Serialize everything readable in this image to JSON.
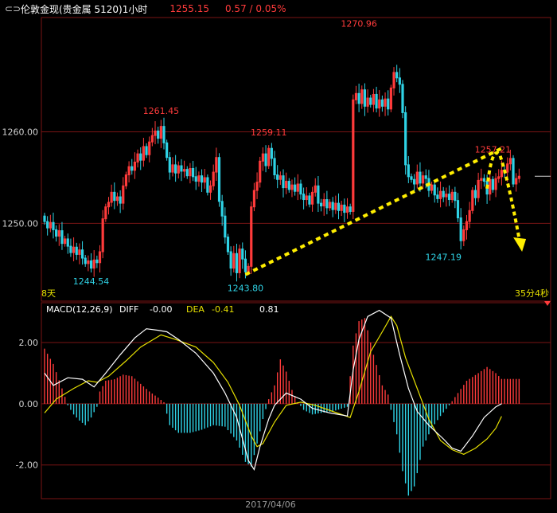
{
  "header": {
    "title": "伦敦金现(贵金属 5120)1小时",
    "last_price": "1255.15",
    "change": "0.57 / 0.05%",
    "link_icon": "link-icon"
  },
  "colors": {
    "background": "#000000",
    "up": "#ff3b3b",
    "down": "#2fd3e6",
    "grid": "#7a1414",
    "axis_text": "#d0d0d0",
    "diff_line": "#ffffff",
    "dea_line": "#e6e000",
    "trend": "#ffee00"
  },
  "chart_data": [
    {
      "type": "candlestick",
      "y_ticks": [
        "1260.00",
        "1250.00"
      ],
      "ylim": [
        1241.5,
        1272.5
      ],
      "annotations": [
        {
          "text": "1261.45",
          "bar": 40,
          "value": 1261.45
        },
        {
          "text": "1270.96",
          "bar": 108,
          "value": 1270.96
        },
        {
          "text": "1259.11",
          "bar": 77,
          "value": 1259.11
        },
        {
          "text": "1257.21",
          "bar": 154,
          "value": 1257.21
        },
        {
          "text": "1244.54",
          "bar": 16,
          "value": 1244.54
        },
        {
          "text": "1243.80",
          "bar": 69,
          "value": 1243.8
        },
        {
          "text": "1247.19",
          "bar": 137,
          "value": 1247.19
        }
      ],
      "corner_left": "8天",
      "corner_right": "35分4秒",
      "x_label": "2017/04/06",
      "closes": [
        1250.2,
        1249.5,
        1250.1,
        1249.3,
        1248.6,
        1249.2,
        1247.8,
        1248.3,
        1247.5,
        1246.8,
        1247.4,
        1246.6,
        1247.1,
        1246.2,
        1245.6,
        1245.9,
        1245.1,
        1246.0,
        1245.7,
        1246.9,
        1250.5,
        1251.8,
        1252.3,
        1253.4,
        1252.5,
        1252.9,
        1252.2,
        1254.1,
        1255.3,
        1256.2,
        1255.8,
        1256.7,
        1257.6,
        1256.9,
        1258.4,
        1257.5,
        1258.9,
        1259.6,
        1260.1,
        1259.3,
        1260.6,
        1258.8,
        1257.2,
        1255.6,
        1256.4,
        1255.5,
        1256.3,
        1255.7,
        1255.9,
        1255.2,
        1256.0,
        1255.1,
        1254.6,
        1255.2,
        1254.5,
        1255.0,
        1253.4,
        1254.1,
        1255.6,
        1257.2,
        1252.4,
        1250.8,
        1248.5,
        1246.9,
        1245.1,
        1246.7,
        1244.6,
        1247.2,
        1246.1,
        1244.7,
        1245.3,
        1251.8,
        1253.6,
        1254.5,
        1256.8,
        1257.6,
        1256.3,
        1258.2,
        1257.1,
        1255.3,
        1254.8,
        1255.2,
        1253.9,
        1254.6,
        1253.7,
        1254.2,
        1253.5,
        1254.3,
        1253.2,
        1252.6,
        1253.0,
        1252.1,
        1253.4,
        1254.1,
        1252.2,
        1251.9,
        1252.6,
        1251.7,
        1252.3,
        1251.5,
        1252.2,
        1251.4,
        1252.0,
        1251.2,
        1251.8,
        1251.3,
        1263.5,
        1264.2,
        1263.1,
        1264.6,
        1262.8,
        1263.7,
        1263.0,
        1264.1,
        1262.6,
        1263.5,
        1262.8,
        1263.6,
        1262.5,
        1264.8,
        1266.5,
        1265.9,
        1265.2,
        1262.1,
        1256.4,
        1255.1,
        1254.8,
        1254.3,
        1255.6,
        1254.4,
        1255.2,
        1254.9,
        1253.6,
        1254.2,
        1253.1,
        1252.7,
        1253.5,
        1252.9,
        1253.2,
        1252.6,
        1253.4,
        1252.5,
        1250.6,
        1248.1,
        1249.3,
        1250.2,
        1251.4,
        1253.6,
        1252.8,
        1254.7,
        1254.9,
        1254.6,
        1253.2,
        1254.8,
        1253.7,
        1254.9,
        1255.1,
        1255.8,
        1255.6,
        1256.5,
        1257.1,
        1254.3,
        1254.9,
        1255.15
      ]
    },
    {
      "type": "macd",
      "legend": {
        "name": "MACD(12,26,9)",
        "diff_label": "DIFF",
        "diff_value": "-0.00",
        "dea_label": "DEA",
        "dea_value": "-0.41",
        "macd_value": "0.81"
      },
      "y_ticks": [
        "2.00",
        "0.00",
        "-2.00"
      ],
      "ylim": [
        -3.1,
        3.3
      ],
      "diff_points": [
        [
          0,
          1.0
        ],
        [
          3,
          0.6
        ],
        [
          8,
          0.85
        ],
        [
          13,
          0.8
        ],
        [
          17,
          0.55
        ],
        [
          21,
          1.0
        ],
        [
          26,
          1.6
        ],
        [
          31,
          2.15
        ],
        [
          35,
          2.45
        ],
        [
          39,
          2.4
        ],
        [
          42,
          2.35
        ],
        [
          46,
          2.1
        ],
        [
          52,
          1.65
        ],
        [
          58,
          1.0
        ],
        [
          62,
          0.35
        ],
        [
          66,
          -0.45
        ],
        [
          70,
          -1.85
        ],
        [
          72,
          -2.15
        ],
        [
          74,
          -1.4
        ],
        [
          77,
          -0.5
        ],
        [
          79,
          -0.05
        ],
        [
          83,
          0.35
        ],
        [
          88,
          0.15
        ],
        [
          92,
          -0.15
        ],
        [
          98,
          -0.3
        ],
        [
          104,
          -0.4
        ],
        [
          106,
          1.1
        ],
        [
          108,
          2.1
        ],
        [
          111,
          2.85
        ],
        [
          115,
          3.05
        ],
        [
          119,
          2.8
        ],
        [
          122,
          1.6
        ],
        [
          125,
          0.5
        ],
        [
          128,
          -0.25
        ],
        [
          132,
          -0.7
        ],
        [
          137,
          -1.15
        ],
        [
          140,
          -1.45
        ],
        [
          143,
          -1.55
        ],
        [
          147,
          -1.05
        ],
        [
          151,
          -0.45
        ],
        [
          155,
          -0.1
        ],
        [
          157,
          0.0
        ]
      ],
      "dea_points": [
        [
          0,
          -0.3
        ],
        [
          4,
          0.15
        ],
        [
          10,
          0.5
        ],
        [
          15,
          0.75
        ],
        [
          18,
          0.7
        ],
        [
          22,
          0.9
        ],
        [
          28,
          1.4
        ],
        [
          33,
          1.85
        ],
        [
          40,
          2.25
        ],
        [
          45,
          2.1
        ],
        [
          52,
          1.85
        ],
        [
          58,
          1.35
        ],
        [
          63,
          0.7
        ],
        [
          67,
          -0.05
        ],
        [
          71,
          -1.05
        ],
        [
          73,
          -1.4
        ],
        [
          75,
          -1.3
        ],
        [
          79,
          -0.6
        ],
        [
          83,
          -0.05
        ],
        [
          88,
          0.05
        ],
        [
          93,
          -0.05
        ],
        [
          99,
          -0.25
        ],
        [
          105,
          -0.45
        ],
        [
          108,
          0.4
        ],
        [
          112,
          1.7
        ],
        [
          116,
          2.35
        ],
        [
          119,
          2.85
        ],
        [
          121,
          2.55
        ],
        [
          124,
          1.5
        ],
        [
          128,
          0.5
        ],
        [
          132,
          -0.5
        ],
        [
          136,
          -1.2
        ],
        [
          140,
          -1.5
        ],
        [
          144,
          -1.65
        ],
        [
          148,
          -1.45
        ],
        [
          152,
          -1.15
        ],
        [
          155,
          -0.8
        ],
        [
          157,
          -0.41
        ]
      ],
      "hist_points": [
        [
          0,
          1.8
        ],
        [
          3,
          1.3
        ],
        [
          6,
          0.5
        ],
        [
          8,
          -0.05
        ],
        [
          10,
          -0.35
        ],
        [
          12,
          -0.55
        ],
        [
          14,
          -0.7
        ],
        [
          16,
          -0.45
        ],
        [
          18,
          -0.1
        ],
        [
          19,
          0.4
        ],
        [
          21,
          0.75
        ],
        [
          24,
          0.8
        ],
        [
          27,
          0.95
        ],
        [
          30,
          0.9
        ],
        [
          33,
          0.65
        ],
        [
          36,
          0.4
        ],
        [
          39,
          0.2
        ],
        [
          41,
          0.05
        ],
        [
          43,
          -0.7
        ],
        [
          46,
          -0.95
        ],
        [
          50,
          -0.95
        ],
        [
          54,
          -0.85
        ],
        [
          58,
          -0.7
        ],
        [
          62,
          -0.75
        ],
        [
          66,
          -1.2
        ],
        [
          69,
          -1.9
        ],
        [
          71,
          -2.05
        ],
        [
          73,
          -1.3
        ],
        [
          75,
          -0.5
        ],
        [
          77,
          0.15
        ],
        [
          79,
          0.6
        ],
        [
          81,
          1.45
        ],
        [
          83,
          1.05
        ],
        [
          85,
          0.45
        ],
        [
          87,
          0.05
        ],
        [
          89,
          -0.2
        ],
        [
          92,
          -0.35
        ],
        [
          95,
          -0.3
        ],
        [
          99,
          -0.25
        ],
        [
          104,
          -0.1
        ],
        [
          106,
          1.9
        ],
        [
          108,
          2.7
        ],
        [
          110,
          2.8
        ],
        [
          113,
          1.6
        ],
        [
          116,
          0.6
        ],
        [
          118,
          0.3
        ],
        [
          119,
          -0.2
        ],
        [
          121,
          -1.0
        ],
        [
          123,
          -2.2
        ],
        [
          125,
          -3.0
        ],
        [
          127,
          -2.7
        ],
        [
          130,
          -1.4
        ],
        [
          133,
          -0.8
        ],
        [
          136,
          -0.4
        ],
        [
          139,
          -0.05
        ],
        [
          142,
          0.35
        ],
        [
          145,
          0.75
        ],
        [
          149,
          1.0
        ],
        [
          152,
          1.2
        ],
        [
          155,
          1.0
        ],
        [
          157,
          0.81
        ]
      ]
    }
  ]
}
